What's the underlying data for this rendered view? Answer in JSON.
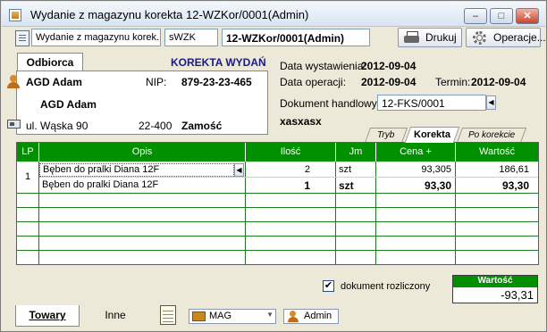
{
  "window": {
    "title": "Wydanie z magazynu korekta 12-WZKor/0001(Admin)",
    "controls": [
      "–",
      "□",
      "✕"
    ]
  },
  "toolbar": {
    "doc_type": "Wydanie z magazynu korek...",
    "series": "sWZK",
    "number": "12-WZKor/0001(Admin)",
    "print_label": "Drukuj",
    "operations_label": "Operacje..."
  },
  "recipient": {
    "tab_label": "Odbiorca",
    "korekta_title": "KOREKTA WYDAŃ",
    "name1": "AGD Adam",
    "nip_label": "NIP:",
    "nip": "879-23-23-465",
    "name2": "AGD Adam",
    "street": "ul. Wąska 90",
    "postal": "22-400",
    "city": "Zamość"
  },
  "dates": {
    "issue_label": "Data wystawienia:",
    "issue_date": "2012-09-04",
    "op_label": "Data operacji:",
    "op_date": "2012-09-04",
    "term_label": "Termin:",
    "term_date": "2012-09-04",
    "trade_doc_label": "Dokument handlowy:",
    "trade_doc": "12-FKS/0001",
    "note": "xasxasx"
  },
  "position_tabs": [
    {
      "label": "Tryb",
      "active": false
    },
    {
      "label": "Korekta",
      "active": true
    },
    {
      "label": "Po korekcie",
      "active": false
    }
  ],
  "grid": {
    "headers": [
      "LP",
      "Opis",
      "Ilość",
      "Jm",
      "Cena +",
      "Wartość"
    ],
    "lp": "1",
    "rows": [
      {
        "opis": "Bęben do pralki Diana 12F",
        "ilosc": "2",
        "jm": "szt",
        "cena": "93,305",
        "wartosc": "186,61"
      },
      {
        "opis": "Bęben do pralki Diana 12F",
        "ilosc": "1",
        "jm": "szt",
        "cena": "93,30",
        "wartosc": "93,30"
      }
    ]
  },
  "footer": {
    "checkbox_label": "dokument rozliczony",
    "checkbox_checked": "✔",
    "sum_label": "Wartość",
    "sum_value": "-93,31",
    "tab_towary": "Towary",
    "tab_inne": "Inne",
    "warehouse": "MAG",
    "user": "Admin"
  },
  "colors": {
    "grid_header": "#009000",
    "grid_lines": "#1f7a1f",
    "window_bg": "#ece9d8"
  }
}
